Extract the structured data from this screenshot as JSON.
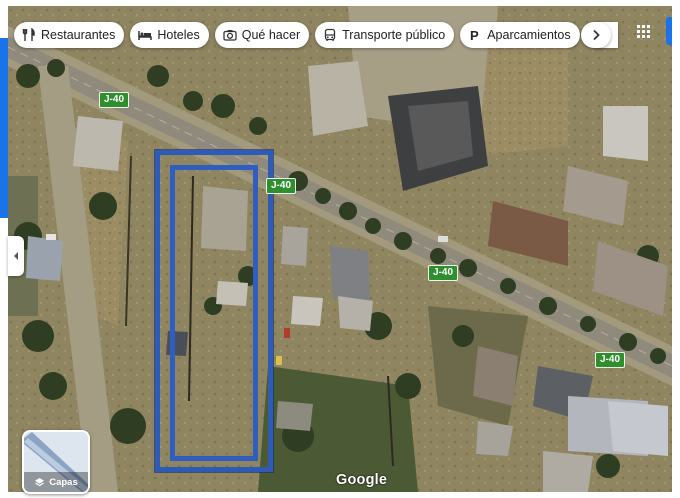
{
  "categories": [
    {
      "label": "Restaurantes",
      "icon": "restaurant-icon"
    },
    {
      "label": "Hoteles",
      "icon": "hotel-bed-icon"
    },
    {
      "label": "Qué hacer",
      "icon": "camera-icon"
    },
    {
      "label": "Transporte público",
      "icon": "bus-icon"
    },
    {
      "label": "Aparcamientos",
      "icon": "parking-icon"
    }
  ],
  "more_categories_icon": "store-icon",
  "scroll_button_icon": "chevron-right-icon",
  "apps_icon": "apps-grid-icon",
  "collapse_icon": "chevron-left-icon",
  "road_labels": [
    "J-40",
    "J-40",
    "J-40",
    "J-40"
  ],
  "layers_button": {
    "label": "Capas",
    "icon": "layers-icon"
  },
  "logo_text": "Google",
  "colors": {
    "parcel_outline": "#2d5bb5",
    "road_shield": "#2f8f2f",
    "accent": "#1a73e8"
  }
}
